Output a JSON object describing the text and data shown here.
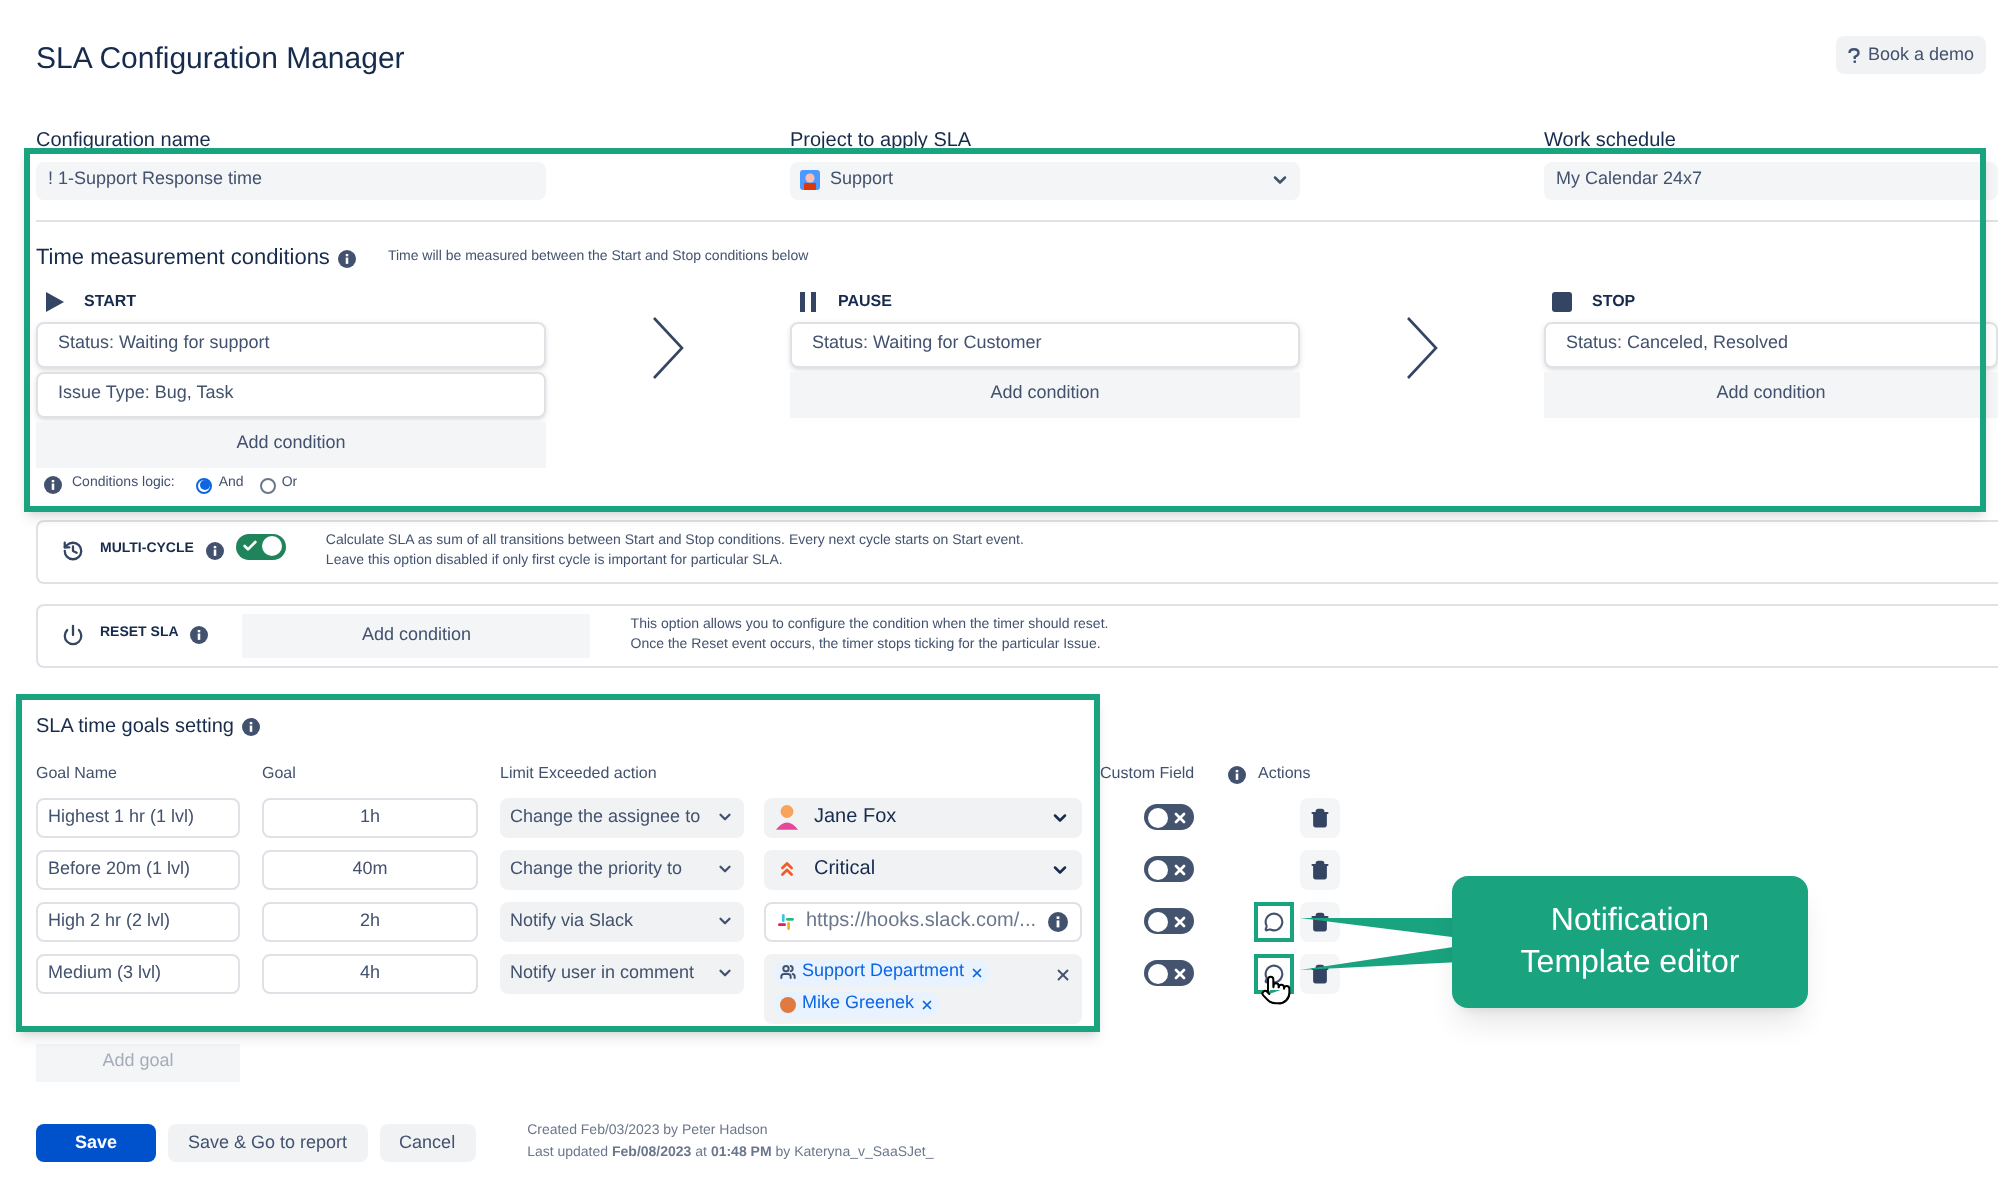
{
  "title": "SLA Configuration Manager",
  "demo_button": "Book a demo",
  "fields": [
    {
      "label": "Configuration name",
      "value": "! 1-Support Response time",
      "kind": "text"
    },
    {
      "label": "Project to apply SLA",
      "value": "Support",
      "kind": "select"
    },
    {
      "label": "Work schedule",
      "value": "My Calendar 24x7",
      "kind": "readonly"
    }
  ],
  "time_conditions": {
    "title": "Time measurement conditions",
    "note": "Time will be measured between the Start and Stop conditions below",
    "stages": [
      {
        "name": "START",
        "kind": "start",
        "conditions": [
          "Status: Waiting for support",
          "Issue Type: Bug, Task"
        ],
        "add_button": "Add condition"
      },
      {
        "name": "PAUSE",
        "kind": "pause",
        "conditions": [
          "Status: Waiting for Customer"
        ],
        "add_button": "Add condition"
      },
      {
        "name": "STOP",
        "kind": "stop",
        "conditions": [
          "Status: Canceled, Resolved"
        ],
        "add_button": "Add condition"
      }
    ],
    "logic": {
      "label": "Conditions logic:",
      "options": [
        {
          "label": "And",
          "selected": true
        },
        {
          "label": "Or",
          "selected": false
        }
      ]
    }
  },
  "multi_cycle": {
    "label": "MULTI-CYCLE",
    "on": true,
    "description": [
      "Calculate SLA as sum of all transitions between Start and Stop conditions. Every next cycle starts on Start event.",
      "Leave this option disabled if only first cycle is important for particular SLA."
    ]
  },
  "reset_sla": {
    "label": "RESET SLA",
    "button": "Add condition",
    "description": [
      "This option allows you to configure the condition when the timer should reset.",
      "Once the Reset event occurs, the timer stops ticking for the particular Issue."
    ]
  },
  "goals": {
    "title": "SLA time goals setting",
    "columns": [
      "Goal Name",
      "Goal",
      "Limit Exceeded action",
      "Custom Field",
      "Actions"
    ],
    "rows": [
      {
        "name": "Highest 1 hr (1 lvl)",
        "goal": "1h",
        "action": "Change the assignee to",
        "value": {
          "kind": "user",
          "text": "Jane Fox"
        },
        "custom_field": false,
        "template": false
      },
      {
        "name": "Before 20m (1 lvl)",
        "goal": "40m",
        "action": "Change the priority to",
        "value": {
          "kind": "priority",
          "text": "Critical"
        },
        "custom_field": false,
        "template": false
      },
      {
        "name": "High 2 hr (2 lvl)",
        "goal": "2h",
        "action": "Notify via Slack",
        "value": {
          "kind": "url",
          "text": "https://hooks.slack.com/..."
        },
        "custom_field": false,
        "template": true
      },
      {
        "name": "Medium (3 lvl)",
        "goal": "4h",
        "action": "Notify user in comment",
        "value": {
          "kind": "tags",
          "tags": [
            {
              "kind": "group",
              "text": "Support Department"
            },
            {
              "kind": "user",
              "text": "Mike Greenek"
            }
          ]
        },
        "custom_field": false,
        "template": true
      }
    ],
    "add_goal": "Add goal"
  },
  "buttons": [
    {
      "label": "Save",
      "kind": "primary"
    },
    {
      "label": "Save & Go to report",
      "kind": "secondary"
    },
    {
      "label": "Cancel",
      "kind": "secondary"
    }
  ],
  "meta": [
    "Created Feb/03/2023 by Peter Hadson",
    "Last updated **Feb/08/2023** at **01:48 PM** by Kateryna_v_SaaSJet_"
  ],
  "callout": [
    "Notification",
    "Template editor"
  ]
}
